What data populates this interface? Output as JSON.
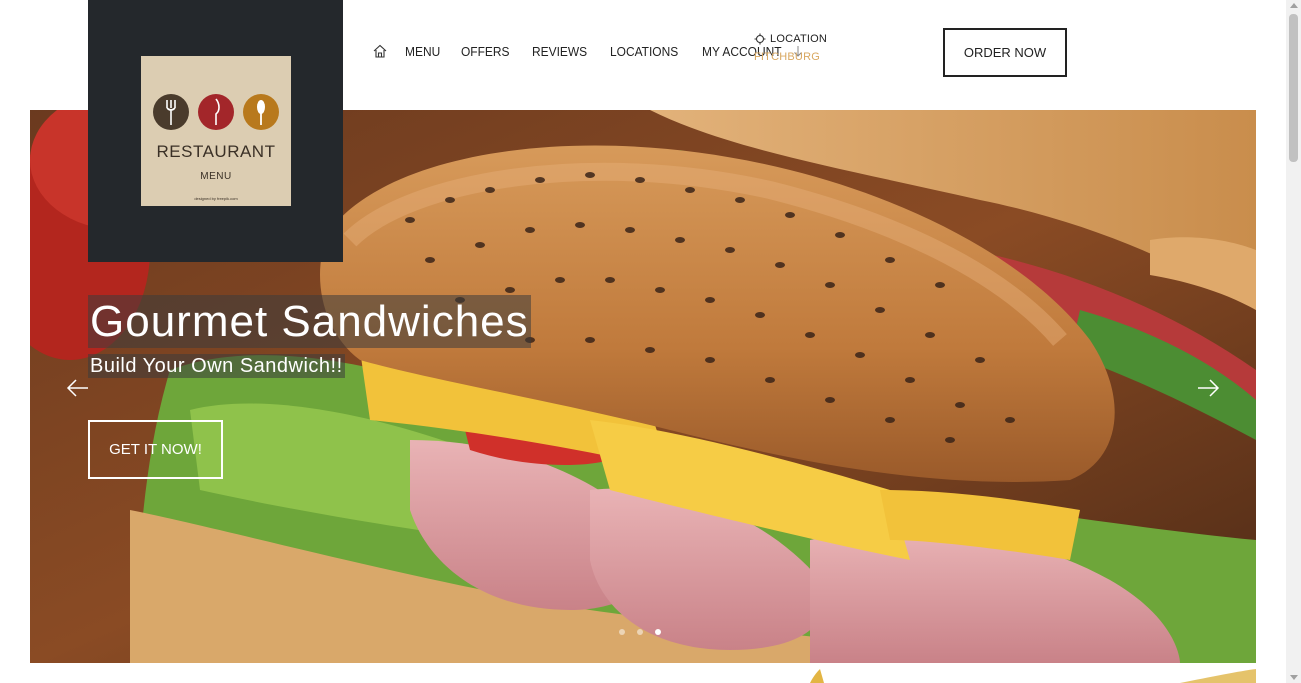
{
  "logo": {
    "brand": "RESTAURANT",
    "sub": "MENU",
    "tiny": "designed by freepik.com"
  },
  "nav": {
    "home_icon": "home-icon",
    "items": [
      "MENU",
      "OFFERS",
      "REVIEWS",
      "LOCATIONS"
    ],
    "account_label": "MY ACCOUNT",
    "account_icon": "arrow-down-icon"
  },
  "location": {
    "label": "LOCATION",
    "city": "FITCHBURG",
    "icon": "location-icon"
  },
  "order_button": "ORDER NOW",
  "hero": {
    "title": "Gourmet Sandwiches",
    "subtitle": "Build Your Own Sandwich!!",
    "cta": "GET IT NOW!",
    "slides_total": 3,
    "active_slide": 3
  },
  "colors": {
    "logo_panel": "#24282c",
    "accent": "#d9a861",
    "text": "#222222"
  }
}
